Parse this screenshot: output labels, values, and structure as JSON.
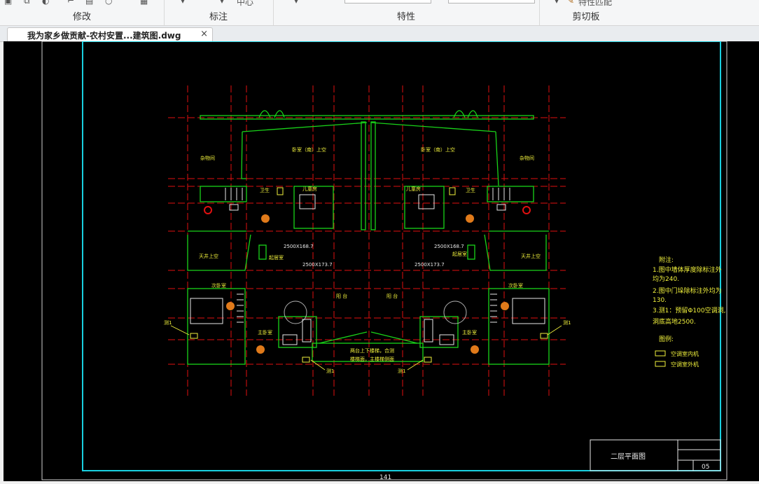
{
  "ribbon": {
    "groups": [
      {
        "label": "修改"
      },
      {
        "label": "标注"
      },
      {
        "label": "特性"
      },
      {
        "label": "剪切板"
      }
    ],
    "partial": {
      "center_label": "中心",
      "match_props": "特性匹配"
    }
  },
  "document_tab": {
    "title": "我为家乡做贡献-农村安置...建筑图.dwg",
    "close": "×"
  },
  "drawing": {
    "rooms": {
      "storage_l": "杂物间",
      "storage_r": "杂物间",
      "bedroom_l": "卧室（南）上空",
      "bedroom_r": "卧室（南）上空",
      "toilet_l": "卫生",
      "toilet_r": "卫生",
      "bath_l": "儿童房",
      "bath_r": "儿童房",
      "void_l": "天井上空",
      "void_r": "天井上空",
      "hall_l": "起居室",
      "hall_r": "起居室",
      "master_l": "次卧室",
      "master_r": "次卧室",
      "main_l": "主卧室",
      "main_r": "主卧室",
      "corridor_l": "阳  台",
      "corridor_r": "阳  台",
      "stair_note1": "两台上下楼梯，合测",
      "stair_note2": "楼梯面，主楼梯侧面"
    },
    "dims": {
      "d1": "2500X168.7",
      "d2": "2500X168.7",
      "d3": "2500X173.7",
      "d4": "2500X173.7"
    },
    "markers": {
      "m1": "测1",
      "m2": "测1",
      "m3": "测1",
      "m4": "测1"
    },
    "notes": {
      "title": "附注:",
      "lines": [
        "1.图中墙体厚度除标注外",
        "  均为240.",
        "2.图中门垛除标注外均为",
        "  130.",
        "3.测1：预留Φ100空调洞,",
        "  洞底高地2500."
      ],
      "legend_title": "图例:",
      "legend": [
        "空调室内机",
        "空调室外机"
      ]
    },
    "title_block": {
      "name": "二层平面图",
      "number": "05"
    },
    "page_number": "141"
  },
  "colors": {
    "red": "#e01010",
    "green": "#19d419",
    "yellow": "#f0f03c",
    "cyan": "#19d0e0",
    "white": "#e8e8e8"
  }
}
